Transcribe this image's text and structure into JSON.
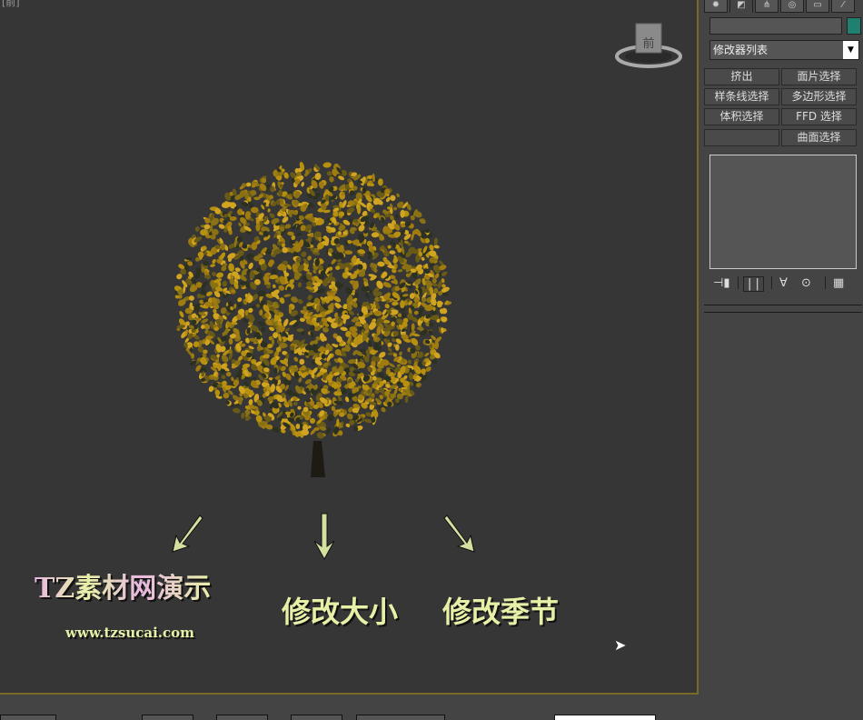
{
  "viewport": {
    "label": "[前]",
    "viewcube_face": "前"
  },
  "captions": {
    "logo": "TZ素材网演示",
    "url": "www.tzsucai.com",
    "size": "修改大小",
    "season": "修改季节"
  },
  "panel": {
    "tabs": [
      "create",
      "modify",
      "hierarchy",
      "motion",
      "display",
      "utilities"
    ],
    "name_value": "",
    "swatch_color": "#1f8070",
    "modifier_list": "修改器列表",
    "buttons": [
      "挤出",
      "面片选择",
      "样条线选择",
      "多边形选择",
      "体积选择",
      "FFD 选择",
      "",
      "曲面选择"
    ]
  },
  "bottom": {
    "search_value": ""
  }
}
